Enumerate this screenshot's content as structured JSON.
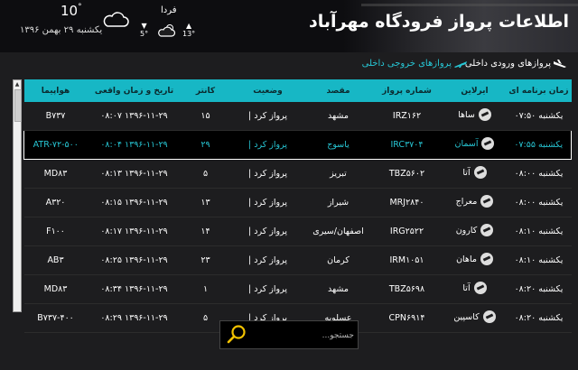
{
  "header": {
    "title": "اطلاعات پرواز فرودگاه مهرآباد",
    "date": "یکشنبه ۲۹ بهمن ۱۳۹۶",
    "weather_now": {
      "temp": "10",
      "deg": "°",
      "icon": "cloud-icon"
    },
    "tomorrow": {
      "label": "فردا",
      "low": "5°",
      "high": "13°",
      "icon": "partly-cloudy-icon"
    }
  },
  "tabs": {
    "arrivals": "پروازهای ورودی داخلی",
    "departures": "پروازهای خروجی داخلی"
  },
  "colors": {
    "accent": "#17b7c5",
    "highlight_text": "#27c6d4"
  },
  "table": {
    "columns": [
      "زمان برنامه ای",
      "ایرلاین",
      "شماره پرواز",
      "مقصد",
      "وضعیت",
      "کانتر",
      "تاریخ و زمان واقعی",
      "هواپیما"
    ],
    "rows": [
      {
        "time": "یکشنبه ۰۷:۵۰",
        "airline": "ساها",
        "flight": "IRZ۱۶۲",
        "dest": "مشهد",
        "status": "پرواز کرد |",
        "counter": "۱۵",
        "actual": "۱۳۹۶-۱۱-۲۹ ۰۸:۰۷",
        "aircraft": "B۷۳۷"
      },
      {
        "time": "یکشنبه ۰۷:۵۵",
        "airline": "آسمان",
        "flight": "IRC۳۷۰۴",
        "dest": "یاسوج",
        "status": "پرواز کرد |",
        "counter": "۲۹",
        "actual": "۱۳۹۶-۱۱-۲۹ ۰۸:۰۴",
        "aircraft": "ATR-۷۲-۵۰۰"
      },
      {
        "time": "یکشنبه ۰۸:۰۰",
        "airline": "آتا",
        "flight": "TBZ۵۶۰۲",
        "dest": "تبریز",
        "status": "پرواز کرد |",
        "counter": "۵",
        "actual": "۱۳۹۶-۱۱-۲۹ ۰۸:۱۳",
        "aircraft": "MD۸۳"
      },
      {
        "time": "یکشنبه ۰۸:۰۰",
        "airline": "معراج",
        "flight": "MRJ۲۸۴۰",
        "dest": "شیراز",
        "status": "پرواز کرد |",
        "counter": "۱۳",
        "actual": "۱۳۹۶-۱۱-۲۹ ۰۸:۱۵",
        "aircraft": "A۳۲۰"
      },
      {
        "time": "یکشنبه ۰۸:۱۰",
        "airline": "کارون",
        "flight": "IRG۲۵۲۲",
        "dest": "اصفهان/سیری",
        "status": "پرواز کرد |",
        "counter": "۱۴",
        "actual": "۱۳۹۶-۱۱-۲۹ ۰۸:۱۷",
        "aircraft": "F۱۰۰"
      },
      {
        "time": "یکشنبه ۰۸:۱۰",
        "airline": "ماهان",
        "flight": "IRM۱۰۵۱",
        "dest": "کرمان",
        "status": "پرواز کرد |",
        "counter": "۲۳",
        "actual": "۱۳۹۶-۱۱-۲۹ ۰۸:۲۵",
        "aircraft": "AB۳"
      },
      {
        "time": "یکشنبه ۰۸:۲۰",
        "airline": "آتا",
        "flight": "TBZ۵۶۹۸",
        "dest": "مشهد",
        "status": "پرواز کرد |",
        "counter": "۱",
        "actual": "۱۳۹۶-۱۱-۲۹ ۰۸:۳۴",
        "aircraft": "MD۸۳"
      },
      {
        "time": "یکشنبه ۰۸:۲۰",
        "airline": "کاسپین",
        "flight": "CPN۶۹۱۴",
        "dest": "عسلویه",
        "status": "پرواز کرد |",
        "counter": "۵",
        "actual": "۱۳۹۶-۱۱-۲۹ ۰۸:۲۹",
        "aircraft": "B۷۳۷-۴۰۰"
      }
    ]
  },
  "search": {
    "placeholder": "جستجو...",
    "icon": "search-icon"
  }
}
